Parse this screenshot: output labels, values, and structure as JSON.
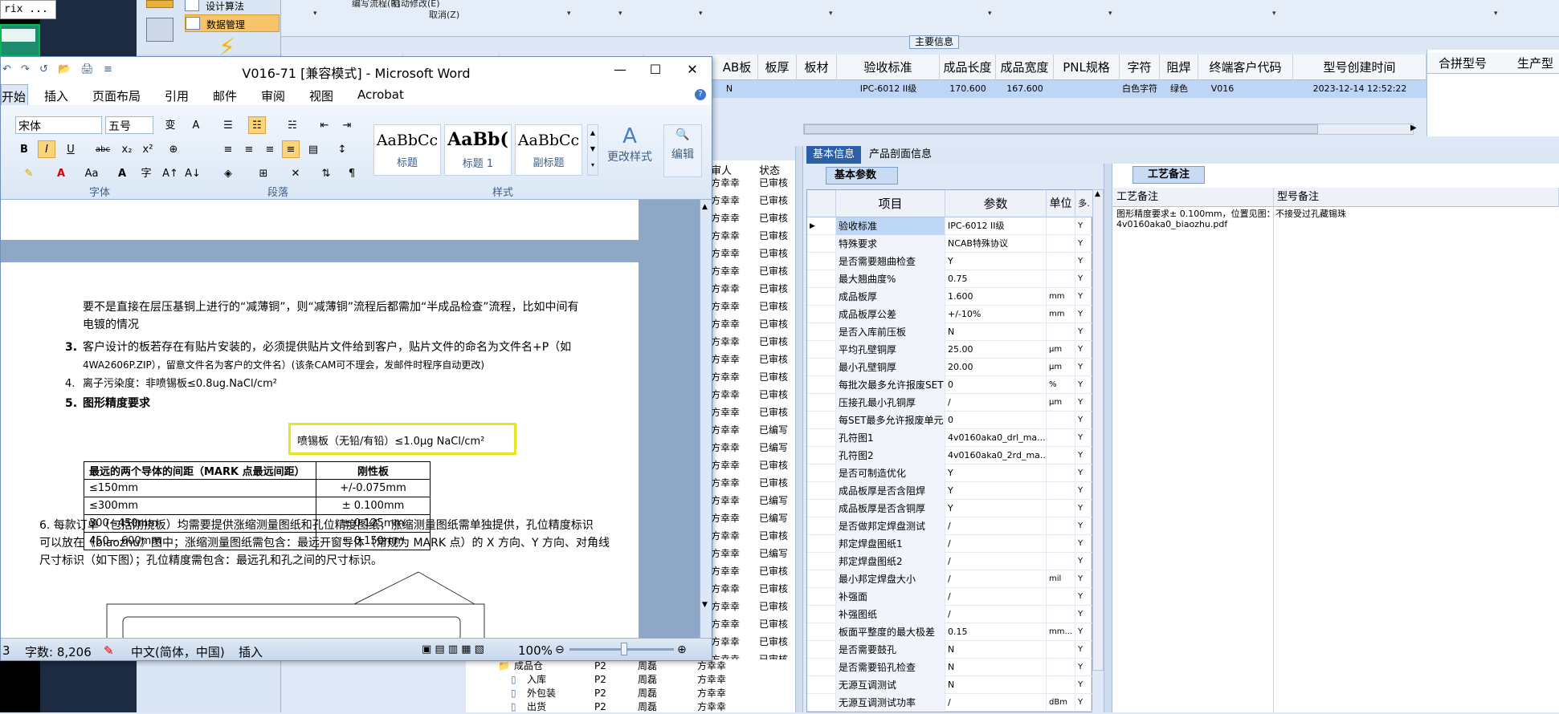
{
  "background_app": {
    "matrix_box": "rix ...",
    "nav": {
      "item1": "设计算法",
      "item2": "数据管理"
    },
    "toolbar": {
      "item1": "编写流程(R)",
      "item2": "启动修改(E)",
      "item3": "取消(Z)"
    },
    "main_section_label": "主要信息",
    "grid_headers": [
      "AB板",
      "板厚",
      "板材",
      "验收标准",
      "成品长度",
      "成品宽度",
      "PNL规格",
      "字符",
      "阻焊",
      "终端客户代码",
      "型号创建时间",
      "合拼型号",
      "生产型"
    ],
    "grid_row": {
      "c0": "N",
      "accept": "IPC-6012 II级",
      "len": "170.600",
      "wid": "167.600",
      "char": "白色字符",
      "mask": "绿色",
      "cust": "V016",
      "time": "2023-12-14 12:52:22"
    },
    "tabs": {
      "basic": "基本信息",
      "product": "产品剖面信息",
      "subtab": "基本参数"
    },
    "param_headers": {
      "item": "项目",
      "param": "参数",
      "unit": "单位",
      "more": "多."
    },
    "params": [
      {
        "item": "验收标准",
        "val": "IPC-6012 II级",
        "unit": "",
        "chk": "Y"
      },
      {
        "item": "特殊要求",
        "val": "NCAB特殊协议",
        "unit": "",
        "chk": "Y"
      },
      {
        "item": "是否需要翘曲检查",
        "val": "Y",
        "unit": "",
        "chk": "Y"
      },
      {
        "item": "最大翘曲度%",
        "val": "0.75",
        "unit": "",
        "chk": "Y"
      },
      {
        "item": "成品板厚",
        "val": "1.600",
        "unit": "mm",
        "chk": "Y"
      },
      {
        "item": "成品板厚公差",
        "val": "+/-10%",
        "unit": "mm",
        "chk": "Y"
      },
      {
        "item": "是否入库前压板",
        "val": "N",
        "unit": "",
        "chk": "Y"
      },
      {
        "item": "平均孔壁铜厚",
        "val": "25.00",
        "unit": "μm",
        "chk": "Y"
      },
      {
        "item": "最小孔壁铜厚",
        "val": "20.00",
        "unit": "μm",
        "chk": "Y"
      },
      {
        "item": "每批次最多允许报废SET",
        "val": "0",
        "unit": "%",
        "chk": "Y"
      },
      {
        "item": "压接孔最小孔铜厚",
        "val": "/",
        "unit": "μm",
        "chk": "Y"
      },
      {
        "item": "每SET最多允许报废单元",
        "val": "0",
        "unit": "",
        "chk": "Y"
      },
      {
        "item": "孔符图1",
        "val": "4v0160aka0_drl_ma...",
        "unit": "",
        "chk": "Y"
      },
      {
        "item": "孔符图2",
        "val": "4v0160aka0_2rd_ma...",
        "unit": "",
        "chk": "Y"
      },
      {
        "item": "是否可制造优化",
        "val": "Y",
        "unit": "",
        "chk": "Y"
      },
      {
        "item": "成品板厚是否含阻焊",
        "val": "Y",
        "unit": "",
        "chk": "Y"
      },
      {
        "item": "成品板厚是否含铜厚",
        "val": "Y",
        "unit": "",
        "chk": "Y"
      },
      {
        "item": "是否做邦定焊盘测试",
        "val": "/",
        "unit": "",
        "chk": "Y"
      },
      {
        "item": "邦定焊盘图纸1",
        "val": "/",
        "unit": "",
        "chk": "Y"
      },
      {
        "item": "邦定焊盘图纸2",
        "val": "/",
        "unit": "",
        "chk": "Y"
      },
      {
        "item": "最小邦定焊盘大小",
        "val": "/",
        "unit": "mil",
        "chk": "Y"
      },
      {
        "item": "补强面",
        "val": "/",
        "unit": "",
        "chk": "Y"
      },
      {
        "item": "补强图纸",
        "val": "/",
        "unit": "",
        "chk": "Y"
      },
      {
        "item": "板面平整度的最大极差",
        "val": "0.15",
        "unit": "mm...",
        "chk": "Y"
      },
      {
        "item": "是否需要鼓孔",
        "val": "N",
        "unit": "",
        "chk": "Y"
      },
      {
        "item": "是否需要铅孔检查",
        "val": "N",
        "unit": "",
        "chk": "Y"
      },
      {
        "item": "无源互调测试",
        "val": "N",
        "unit": "",
        "chk": "Y"
      },
      {
        "item": "无源互调测试功率",
        "val": "/",
        "unit": "dBm",
        "chk": "Y"
      }
    ],
    "craft": {
      "tab": "工艺备注",
      "col1": "工艺备注",
      "col2": "型号备注",
      "note1": "图形精度要求± 0.100mm，位置见图：4v0160aka0_biaozhu.pdf",
      "note2": "不接受过孔藏锡珠"
    },
    "mid": {
      "col1": "审人",
      "col2": "状态",
      "names": [
        "方幸幸",
        "方幸幸",
        "方幸幸",
        "方幸幸",
        "方幸幸",
        "方幸幸",
        "方幸幸",
        "方幸幸",
        "方幸幸",
        "方幸幸",
        "方幸幸",
        "方幸幸",
        "方幸幸",
        "方幸幸",
        "方幸幸",
        "方幸幸",
        "方幸幸",
        "方幸幸",
        "方幸幸",
        "方幸幸",
        "方幸幸",
        "方幸幸",
        "方幸幸",
        "方幸幸",
        "方幸幸",
        "方幸幸",
        "方幸幸",
        "方幸幸",
        "方幸幸"
      ],
      "status": [
        "已审核",
        "已审核",
        "已审核",
        "已审核",
        "已审核",
        "已审核",
        "已审核",
        "已审核",
        "已审核",
        "已审核",
        "已审核",
        "已审核",
        "已审核",
        "已审核",
        "已编写",
        "已编写",
        "已审核",
        "已审核",
        "已编写",
        "已编写",
        "已审核",
        "已编写",
        "已审核",
        "已审核",
        "已审核",
        "已审核",
        "已审核",
        "已审核",
        "已审核",
        "已审核"
      ]
    },
    "tree": [
      {
        "label": "成品仓",
        "p": "P2",
        "who": "周磊",
        "rev": "方幸幸"
      },
      {
        "label": "入库",
        "p": "P2",
        "who": "周磊",
        "rev": "方幸幸"
      },
      {
        "label": "外包装",
        "p": "P2",
        "who": "周磊",
        "rev": "方幸幸"
      },
      {
        "label": "出货",
        "p": "P2",
        "who": "周磊",
        "rev": "方幸幸"
      }
    ]
  },
  "word": {
    "title": "V016-71 [兼容模式] - Microsoft Word",
    "tabs": [
      "开始",
      "插入",
      "页面布局",
      "引用",
      "邮件",
      "审阅",
      "视图",
      "Acrobat"
    ],
    "font": "宋体",
    "size": "五号",
    "groups": {
      "font": "字体",
      "para": "段落",
      "style": "样式"
    },
    "styles": [
      {
        "sample": "AaBbCc",
        "name": "标题"
      },
      {
        "sample": "AaBb(",
        "name": "标题 1"
      },
      {
        "sample": "AaBbCc",
        "name": "副标题"
      }
    ],
    "change_style": "更改样式",
    "edit": "编辑",
    "doc": {
      "p1": "要不是直接在层压基铜上进行的“减薄铜”，则“减薄铜”流程后都需加“半成品检查”流程，比如中间有",
      "p1b": "电镀的情况",
      "p3": "客户设计的板若存在有贴片安装的，必须提供贴片文件给到客户，贴片文件的命名为文件名+P（如",
      "p3b": "4WA2606P.ZIP），留意文件名为客户的文件名）(该条CAM可不理会，发邮件时程序自动更改)",
      "p4": "离子污染度：非喷锡板≤0.8ug.NaCl/cm²",
      "p4b": "喷锡板（无铅/有铅）≤1.0μg NaCl/cm²",
      "p5": "图形精度要求",
      "table": [
        [
          "最远的两个导体的间距（MARK 点最远间距）",
          "刚性板"
        ],
        [
          "≤150mm",
          "+/-0.075mm"
        ],
        [
          "≤300mm",
          "± 0.100mm"
        ],
        [
          "300~450mm",
          "± 0.125mm"
        ],
        [
          "450~ 600mm",
          "± 0.150mm"
        ]
      ],
      "p6": "6.  每款订单（包括刚挠板）均需要提供涨缩测量图纸和孔位精度图纸，涨缩测量图纸需单独提供，孔位精度标识",
      "p6b": "可以放在《biaozhu》图中；涨缩测量图纸需包含：最远开窗导体（常规为 MARK 点）的 X 方向、Y 方向、对角线",
      "p6c": "尺寸标识（如下图）；孔位精度需包含：最远孔和孔之间的尺寸标识。"
    },
    "status": {
      "page": "3",
      "words": "字数: 8,206",
      "lang": "中文(简体，中国)",
      "mode": "插入",
      "zoom": "100%"
    }
  }
}
